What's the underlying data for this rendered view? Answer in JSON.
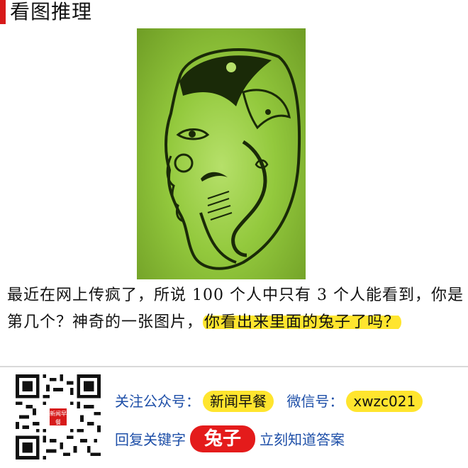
{
  "header": {
    "title": "看图推理"
  },
  "caption": {
    "plain": "最近在网上传疯了，所说 100 个人中只有 3 个人能看到，你是第几个？神奇的一张图片，",
    "highlight": "你看出来里面的兔子了吗？"
  },
  "footer": {
    "follow_label": "关注公众号：",
    "account_name": "新闻早餐",
    "wechat_label": "微信号：",
    "wechat_id": "xwzc021",
    "reply_prefix": "回复关键字",
    "keyword": "兔子",
    "reply_suffix": "立刻知道答案",
    "qr_logo_text": "新闻早餐"
  },
  "colors": {
    "accent": "#d71a1a",
    "highlight": "#ffe52e",
    "link_blue": "#1e4fa8"
  },
  "icons": {
    "qr": "qr-code-icon"
  }
}
